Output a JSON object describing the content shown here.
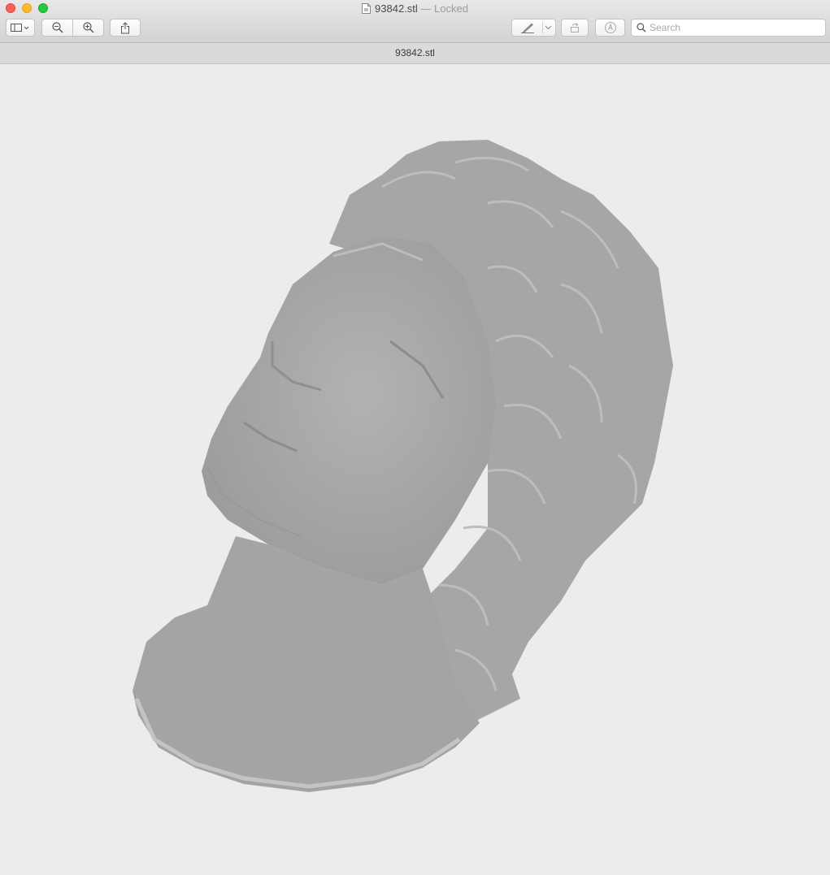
{
  "window": {
    "file_name": "93842.stl",
    "title_suffix": "— Locked"
  },
  "toolbar": {
    "sidebar_button": "sidebar-toggle-icon",
    "zoom_out_button": "zoom-out-icon",
    "zoom_in_button": "zoom-in-icon",
    "share_button": "share-icon",
    "markup_button": "pen-icon",
    "rotate_button": "rotate-icon",
    "annotate_button": "markup-icon"
  },
  "search": {
    "placeholder": "Search",
    "value": ""
  },
  "tab": {
    "label": "93842.stl"
  },
  "viewer": {
    "content": "3D bust model"
  },
  "colors": {
    "close": "#fc5f57",
    "minimize": "#fdbc2e",
    "maximize": "#28c840",
    "background": "#ececec",
    "model": "#a9a9a9"
  }
}
